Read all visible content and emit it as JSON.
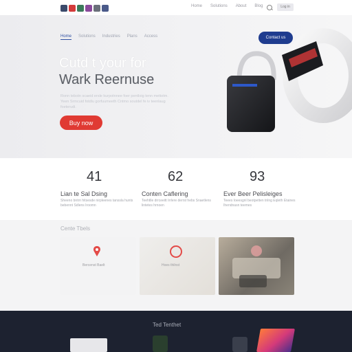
{
  "topnav": {
    "items": [
      "Home",
      "Solutions",
      "About",
      "Blog"
    ]
  },
  "topbar_button": "Log in",
  "hero": {
    "subnav": [
      "Home",
      "Solutions",
      "Industries",
      "Plans",
      "Access"
    ],
    "cta_top": "Contact us",
    "headline_line1": "Cutd t your for",
    "headline_line2": "Wark Reernuse",
    "subtext": "Ronn tebotn scaeid ersle kurpotnnee foer pentloig tenn mettotm. Yeen Srmcuid fotdlu gorfuumeeth Cntmo soutdel fe iv teenlaug foeterudi.",
    "buy_button": "Buy now"
  },
  "stats": [
    {
      "value": "41",
      "label": "Lian te Sal Dsing",
      "desc": "Sheeno bntrn hitsesde nirpleenes tanssla hunts bebennt Sdlens Iroomn"
    },
    {
      "value": "62",
      "label": "Conten Caflering",
      "desc": "Teehtlle drrceeitt Irrlere derrsl hebs Snaetlens lintetes hrnoen"
    },
    {
      "value": "93",
      "label": "Ever Beer Pelisleiges",
      "desc": "Teees Ioeesgnl beotpetten tnlng Eqleth Etaines Ihendnasn teemes"
    }
  ],
  "cards_section": {
    "title": "Cente Tbels",
    "cards": [
      {
        "caption": "Bercenst Baelt"
      },
      {
        "caption": "Hoes thilnst"
      },
      {
        "caption": ""
      }
    ]
  },
  "footer": {
    "title": "Ted Tenthet"
  },
  "colors": {
    "accent_red": "#e03a33",
    "accent_blue": "#1f3c8f",
    "footer_bg": "#1d2230"
  }
}
